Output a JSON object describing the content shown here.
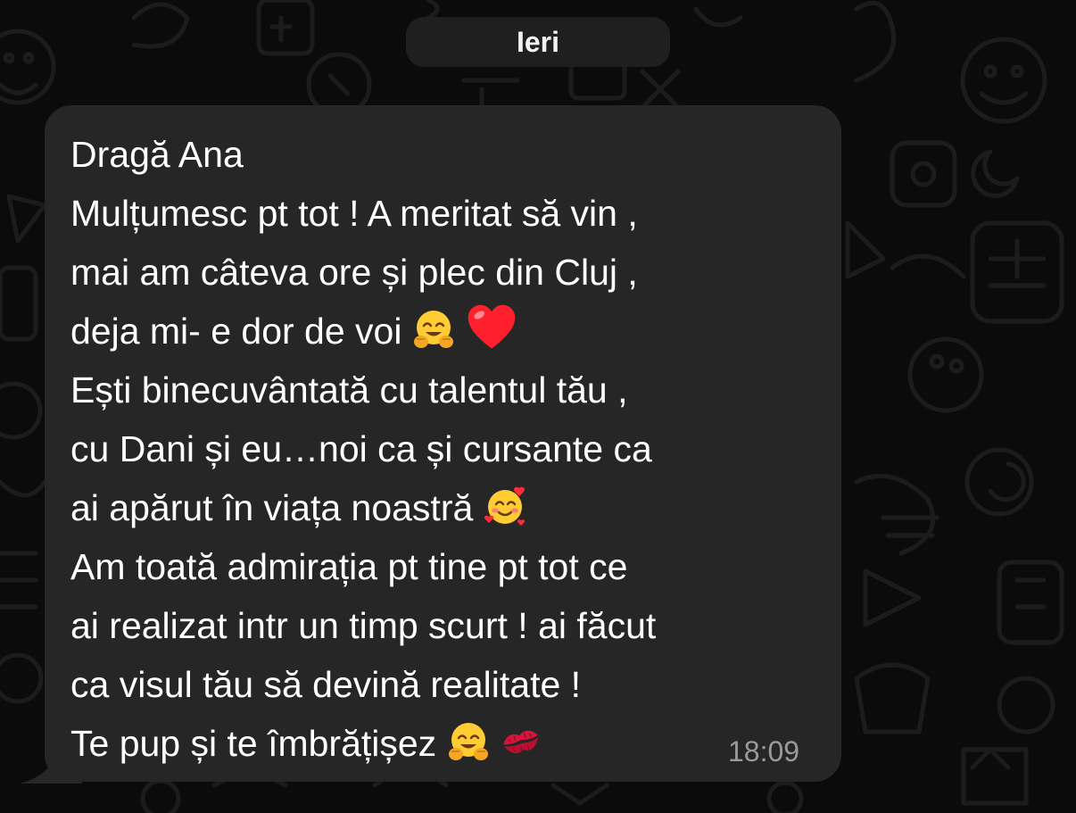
{
  "date_separator": "Ieri",
  "message": {
    "lines": [
      {
        "text": "Dragă Ana",
        "emojis": []
      },
      {
        "text": "Mulțumesc pt tot ! A meritat să vin ,",
        "emojis": []
      },
      {
        "text": "mai am câteva ore și plec din Cluj ,",
        "emojis": []
      },
      {
        "text": "deja mi- e dor de voi ",
        "emojis": [
          "hugging-face-emoji",
          "red-heart-emoji"
        ]
      },
      {
        "text": "Ești binecuvântată cu talentul tău ,",
        "emojis": []
      },
      {
        "text": "cu Dani și eu…noi ca și cursante ca",
        "emojis": []
      },
      {
        "text": "ai apărut în viața noastră ",
        "emojis": [
          "smiling-face-with-hearts-emoji"
        ]
      },
      {
        "text": "Am toată admirația pt tine pt tot ce",
        "emojis": []
      },
      {
        "text": "ai realizat intr un timp scurt ! ai făcut",
        "emojis": []
      },
      {
        "text": "ca visul tău să devină realitate !",
        "emojis": []
      },
      {
        "text": "Te pup și te îmbrățișez ",
        "emojis": [
          "hugging-face-emoji",
          "kiss-mark-emoji"
        ]
      }
    ],
    "time": "18:09"
  },
  "colors": {
    "background": "#0b0b0b",
    "bubble": "#262626",
    "date_pill": "#1f1f1f",
    "message_text": "#ffffff",
    "timestamp": "#9a9a9a"
  }
}
